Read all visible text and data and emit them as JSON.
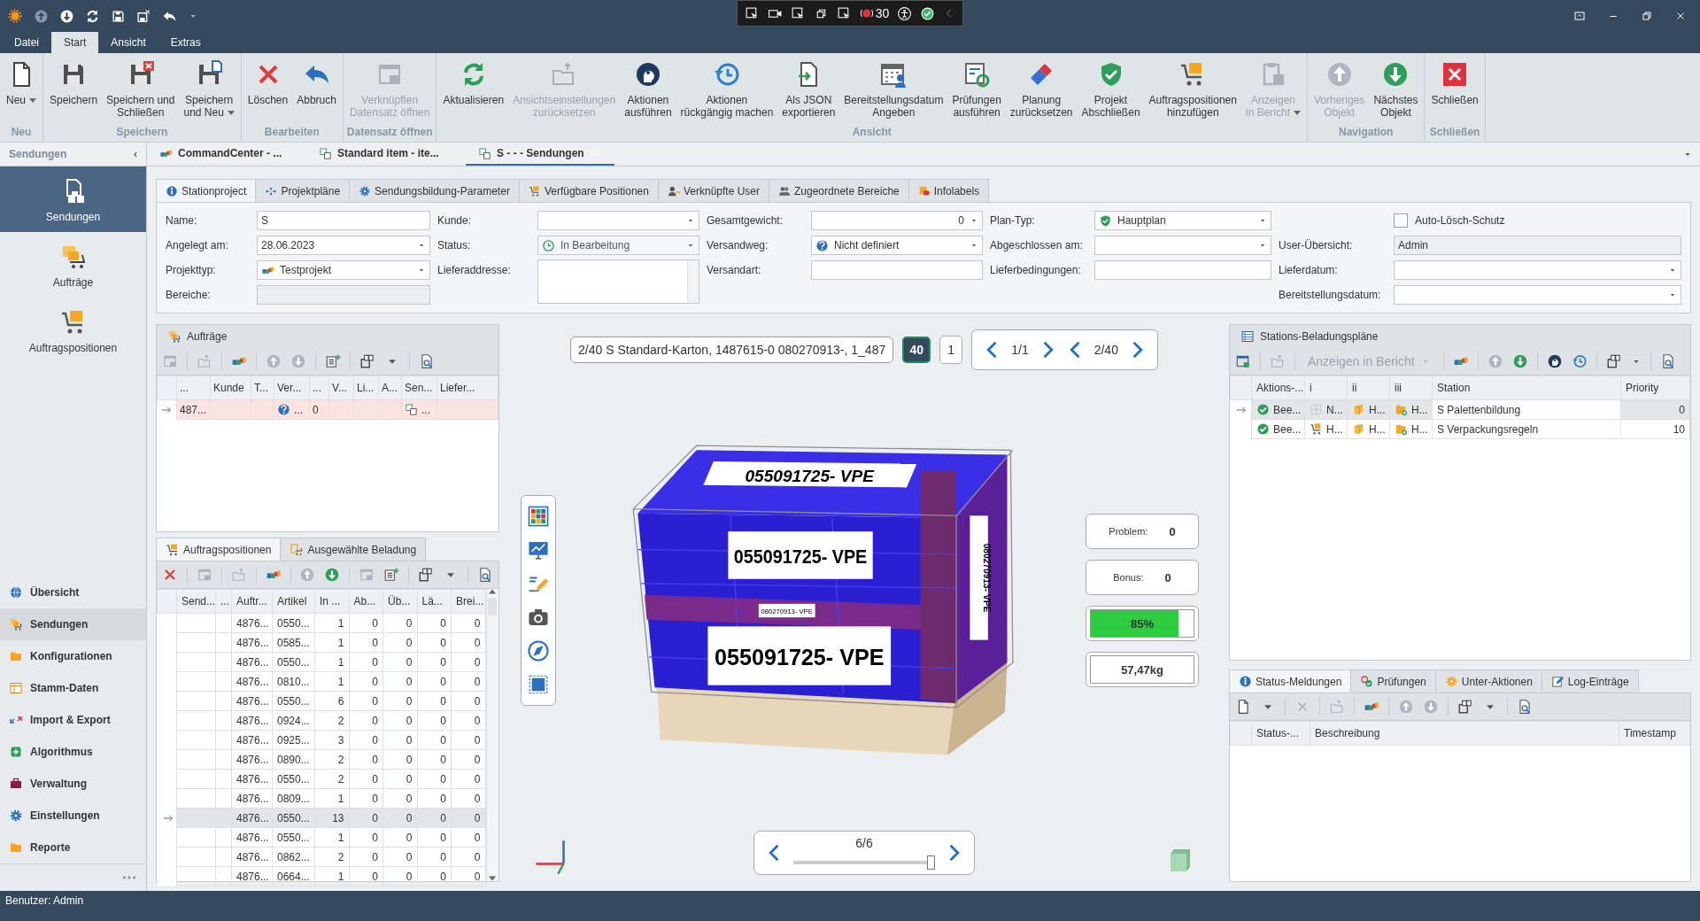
{
  "title_bar": {
    "debug_counter": "30"
  },
  "ribbon": {
    "tabs": [
      {
        "label": "Datei",
        "selected": false
      },
      {
        "label": "Start",
        "selected": true
      },
      {
        "label": "Ansicht",
        "selected": false
      },
      {
        "label": "Extras",
        "selected": false
      }
    ],
    "groups": [
      {
        "label": "Neu",
        "buttons": [
          {
            "label": "Neu",
            "disabled": false,
            "dropdown": true
          }
        ]
      },
      {
        "label": "Speichern",
        "buttons": [
          {
            "label": "Speichern",
            "disabled": false,
            "dropdown": false
          },
          {
            "label": "Speichern und\nSchließen",
            "disabled": false,
            "dropdown": false
          },
          {
            "label": "Speichern\nund Neu",
            "disabled": false,
            "dropdown": true
          }
        ]
      },
      {
        "label": "Bearbeiten",
        "buttons": [
          {
            "label": "Löschen",
            "disabled": false,
            "dropdown": false
          },
          {
            "label": "Abbruch",
            "disabled": false,
            "dropdown": false
          }
        ]
      },
      {
        "label": "Datensatz öffnen",
        "buttons": [
          {
            "label": "Verknüpften\nDatensatz öffnen",
            "disabled": true,
            "dropdown": false
          }
        ]
      },
      {
        "label": "Ansicht",
        "buttons": [
          {
            "label": "Aktualisieren",
            "disabled": false,
            "dropdown": false
          },
          {
            "label": "Ansichtseinstellungen\nzurücksetzen",
            "disabled": true,
            "dropdown": false
          },
          {
            "label": "Aktionen\nausführen",
            "disabled": false,
            "dropdown": false
          },
          {
            "label": "Aktionen\nrückgängig machen",
            "disabled": false,
            "dropdown": false
          },
          {
            "label": "Als JSON\nexportieren",
            "disabled": false,
            "dropdown": false
          },
          {
            "label": "Bereitstellungsdatum\nAngeben",
            "disabled": false,
            "dropdown": false
          },
          {
            "label": "Prüfungen\nausführen",
            "disabled": false,
            "dropdown": false
          },
          {
            "label": "Planung\nzurücksetzen",
            "disabled": false,
            "dropdown": false
          },
          {
            "label": "Projekt\nAbschließen",
            "disabled": false,
            "dropdown": false
          },
          {
            "label": "Auftragspositionen\nhinzufügen",
            "disabled": false,
            "dropdown": false
          },
          {
            "label": "Anzeigen\nin Bericht",
            "disabled": true,
            "dropdown": true
          }
        ]
      },
      {
        "label": "Navigation",
        "buttons": [
          {
            "label": "Vorheriges\nObjekt",
            "disabled": true,
            "dropdown": false
          },
          {
            "label": "Nächstes\nObjekt",
            "disabled": false,
            "dropdown": false
          }
        ]
      },
      {
        "label": "Schließen",
        "buttons": [
          {
            "label": "Schließen",
            "disabled": false,
            "dropdown": false
          }
        ]
      }
    ]
  },
  "sidebar": {
    "title": "Sendungen",
    "collapse": "‹",
    "modules": [
      {
        "label": "Sendungen",
        "selected": true
      },
      {
        "label": "Aufträge",
        "selected": false
      },
      {
        "label": "Auftragspositionen",
        "selected": false
      }
    ],
    "nav": [
      {
        "label": "Übersicht",
        "selected": false
      },
      {
        "label": "Sendungen",
        "selected": true
      },
      {
        "label": "Konfigurationen",
        "selected": false
      },
      {
        "label": "Stamm-Daten",
        "selected": false
      },
      {
        "label": "Import & Export",
        "selected": false
      },
      {
        "label": "Algorithmus",
        "selected": false
      },
      {
        "label": "Verwaltung",
        "selected": false
      },
      {
        "label": "Einstellungen",
        "selected": false
      },
      {
        "label": "Reporte",
        "selected": false
      }
    ]
  },
  "document_tabs": [
    {
      "label": "CommandCenter - ...",
      "selected": false
    },
    {
      "label": "Standard item - ite...",
      "selected": false
    },
    {
      "label": "S - - - Sendungen",
      "selected": true
    }
  ],
  "form_tabs": [
    {
      "label": "Stationproject",
      "selected": true
    },
    {
      "label": "Projektpläne",
      "selected": false
    },
    {
      "label": "Sendungsbildung-Parameter",
      "selected": false
    },
    {
      "label": "Verfügbare Positionen",
      "selected": false
    },
    {
      "label": "Verknüpfte User",
      "selected": false
    },
    {
      "label": "Zugeordnete Bereiche",
      "selected": false
    },
    {
      "label": "Infolabels",
      "selected": false
    }
  ],
  "form": {
    "columns": [
      [
        {
          "label": "Name:",
          "kind": "text",
          "value": "S"
        },
        {
          "label": "Angelegt am:",
          "kind": "dropdown",
          "value": "28.06.2023"
        },
        {
          "label": "Projekttyp:",
          "kind": "dropdown",
          "value": "Testprojekt"
        },
        {
          "label": "Bereiche:",
          "kind": "readonly"
        }
      ],
      [
        {
          "label": "Kunde:",
          "kind": "dropdown"
        },
        {
          "label": "Status:",
          "kind": "dropdown",
          "value": "In Bearbeitung",
          "disabled": true
        },
        {
          "label": "Lieferaddresse:",
          "kind": "memo"
        }
      ],
      [
        {
          "label": "Gesamtgewicht:",
          "kind": "spin",
          "value": "0"
        },
        {
          "label": "Versandweg:",
          "kind": "dropdown",
          "value": "Nicht definiert"
        },
        {
          "label": "Versandart:",
          "kind": "text"
        }
      ],
      [
        {
          "label": "Plan-Typ:",
          "kind": "dropdown",
          "value": "Hauptplan"
        },
        {
          "label": "Abgeschlossen am:",
          "kind": "dropdown"
        },
        {
          "label": "Lieferbedingungen:",
          "kind": "text"
        }
      ],
      [
        {
          "label": "Auto-Lösch-Schutz",
          "kind": "checkbox",
          "checked": false
        },
        {
          "label": "User-Übersicht:",
          "kind": "readonly",
          "value": "Admin"
        },
        {
          "label": "Lieferdatum:",
          "kind": "dropdown"
        },
        {
          "label": "Bereitstellungsdatum:",
          "kind": "dropdown"
        }
      ]
    ]
  },
  "orders": {
    "title": "Aufträge",
    "columns": [
      "...",
      "Kunde",
      "T...",
      "Ver...",
      "...",
      "V...",
      "Li...",
      "A...",
      "Sen...",
      "Liefer..."
    ],
    "rows": [
      {
        "id": "487...",
        "shipping": "...",
        "count": "0",
        "shipment": "...",
        "selected": true
      }
    ]
  },
  "positions": {
    "tabs": [
      {
        "label": "Auftragspositionen",
        "selected": true
      },
      {
        "label": "Ausgewählte Beladung",
        "selected": false
      }
    ],
    "columns": [
      "Send...",
      "...",
      "Auftr...",
      "Artikel",
      "In ...",
      "Ab...",
      "Üb...",
      "Lä...",
      "Brei..."
    ],
    "rows": [
      {
        "order": "4876...",
        "article": "0550...",
        "values": [
          "1",
          "0",
          "0",
          "0",
          "0"
        ],
        "selected": false
      },
      {
        "order": "4876...",
        "article": "0585...",
        "values": [
          "1",
          "0",
          "0",
          "0",
          "0"
        ],
        "selected": false
      },
      {
        "order": "4876...",
        "article": "0550...",
        "values": [
          "1",
          "0",
          "0",
          "0",
          "0"
        ],
        "selected": false
      },
      {
        "order": "4876...",
        "article": "0810...",
        "values": [
          "1",
          "0",
          "0",
          "0",
          "0"
        ],
        "selected": false
      },
      {
        "order": "4876...",
        "article": "0550...",
        "values": [
          "6",
          "0",
          "0",
          "0",
          "0"
        ],
        "selected": false
      },
      {
        "order": "4876...",
        "article": "0924...",
        "values": [
          "2",
          "0",
          "0",
          "0",
          "0"
        ],
        "selected": false
      },
      {
        "order": "4876...",
        "article": "0925...",
        "values": [
          "3",
          "0",
          "0",
          "0",
          "0"
        ],
        "selected": false
      },
      {
        "order": "4876...",
        "article": "0890...",
        "values": [
          "2",
          "0",
          "0",
          "0",
          "0"
        ],
        "selected": false
      },
      {
        "order": "4876...",
        "article": "0550...",
        "values": [
          "2",
          "0",
          "0",
          "0",
          "0"
        ],
        "selected": false
      },
      {
        "order": "4876...",
        "article": "0809...",
        "values": [
          "1",
          "0",
          "0",
          "0",
          "0"
        ],
        "selected": false
      },
      {
        "order": "4876...",
        "article": "0550...",
        "values": [
          "13",
          "0",
          "0",
          "0",
          "0"
        ],
        "selected": true
      },
      {
        "order": "4876...",
        "article": "0550...",
        "values": [
          "1",
          "0",
          "0",
          "0",
          "0"
        ],
        "selected": false
      },
      {
        "order": "4876...",
        "article": "0862...",
        "values": [
          "2",
          "0",
          "0",
          "0",
          "0"
        ],
        "selected": false
      },
      {
        "order": "4876...",
        "article": "0664...",
        "values": [
          "1",
          "0",
          "0",
          "0",
          "0"
        ],
        "selected": false
      }
    ]
  },
  "viewer": {
    "search_value": "2/40 S Standard-Karton, 1487615-0 080270913-, 1_487",
    "count_badge": "40",
    "page_badge": "1",
    "pager_a": "1/1",
    "pager_b": "2/40",
    "cargo_labels": [
      "055091725- VPE",
      "055091725- VPE",
      "080270913- VPE",
      "055091725- VPE",
      "080270913- VPE"
    ],
    "stats": {
      "problem_label": "Problem:",
      "problem": "0",
      "bonus_label": "Bonus:",
      "bonus": "0",
      "fill_reading": "85%",
      "level": 0.85,
      "weight": "57,47kg"
    },
    "layer": {
      "reading": "6/6",
      "level": 1
    }
  },
  "plans": {
    "title": "Stations-Beladungspläne",
    "report_button": "Anzeigen in Bericht",
    "columns": [
      "Aktions-...",
      "i",
      "ii",
      "iii",
      "Station",
      "Priority"
    ],
    "rows": [
      {
        "action": "Bee...",
        "i": "N...",
        "ii": "H...",
        "iii": "H...",
        "station": "S Palettenbildung",
        "priority": "0",
        "selected": true
      },
      {
        "action": "Bee...",
        "i": "H...",
        "ii": "H...",
        "iii": "H...",
        "station": "S Verpackungsregeln",
        "priority": "10",
        "selected": false
      }
    ]
  },
  "messages": {
    "tabs": [
      {
        "label": "Status-Meldungen",
        "selected": true
      },
      {
        "label": "Prüfungen",
        "selected": false
      },
      {
        "label": "Unter-Aktionen",
        "selected": false
      },
      {
        "label": "Log-Einträge",
        "selected": false
      }
    ],
    "columns": [
      "Status-...",
      "Beschreibung",
      "Timestamp"
    ]
  },
  "status_bar": {
    "user": "Benutzer: Admin"
  }
}
